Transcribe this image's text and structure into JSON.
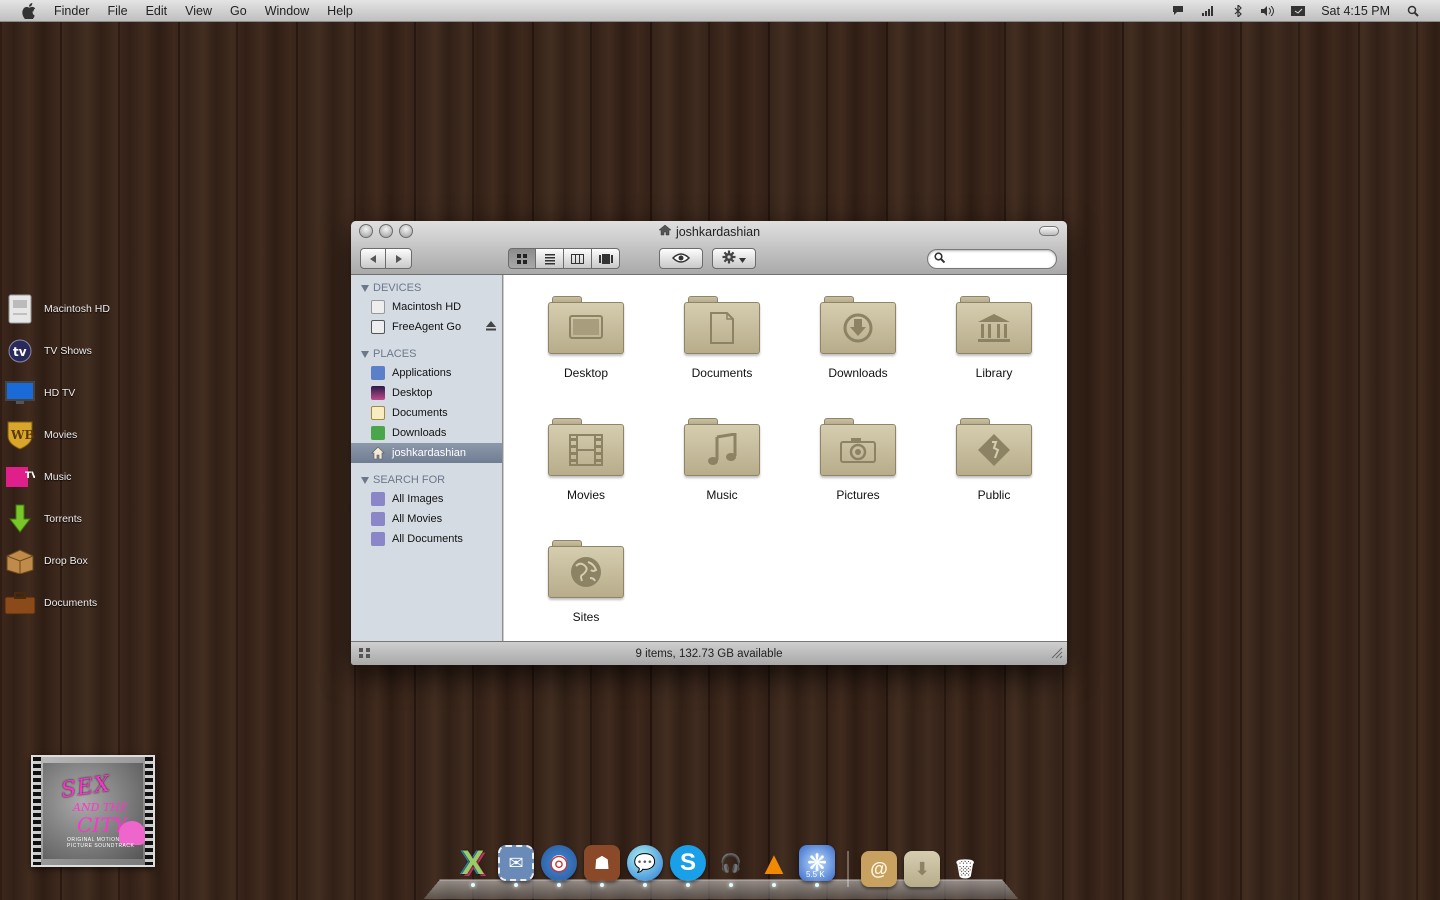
{
  "menubar": {
    "app_name": "Finder",
    "menus": [
      "File",
      "Edit",
      "View",
      "Go",
      "Window",
      "Help"
    ],
    "clock": "Sat 4:15 PM",
    "status_icons": [
      "chat-icon",
      "signal-bars-icon",
      "bluetooth-icon",
      "volume-icon",
      "battery-icon",
      "spotlight-icon"
    ]
  },
  "desktop": {
    "items": [
      {
        "label": "Macintosh HD",
        "icon": "hard-drive-icon"
      },
      {
        "label": "TV Shows",
        "icon": "tv-icon"
      },
      {
        "label": "HD TV",
        "icon": "monitor-icon"
      },
      {
        "label": "Movies",
        "icon": "wb-shield-icon"
      },
      {
        "label": "Music",
        "icon": "mtv-icon"
      },
      {
        "label": "Torrents",
        "icon": "download-arrow-icon"
      },
      {
        "label": "Drop Box",
        "icon": "box-icon"
      },
      {
        "label": "Documents",
        "icon": "briefcase-icon"
      }
    ]
  },
  "album": {
    "line1": "SEX",
    "line2": "AND THE",
    "line3": "CITY",
    "subtitle": "ORIGINAL MOTION PICTURE SOUNDTRACK"
  },
  "finder": {
    "title": "joshkardashian",
    "search_placeholder": "",
    "sidebar": {
      "sections": [
        {
          "title": "DEVICES",
          "items": [
            {
              "label": "Macintosh HD",
              "icon": "hard-drive-icon",
              "color": "#e8e8e8"
            },
            {
              "label": "FreeAgent Go",
              "icon": "external-drive-icon",
              "color": "#e8e8e8",
              "eject": true
            }
          ]
        },
        {
          "title": "PLACES",
          "items": [
            {
              "label": "Applications",
              "icon": "applications-icon",
              "color": "#5b7fc9"
            },
            {
              "label": "Desktop",
              "icon": "desktop-icon",
              "color": "#5a3a7a"
            },
            {
              "label": "Documents",
              "icon": "documents-icon",
              "color": "#f5e9b8"
            },
            {
              "label": "Downloads",
              "icon": "downloads-icon",
              "color": "#4aa64a"
            },
            {
              "label": "joshkardashian",
              "icon": "home-icon",
              "color": "#f0e6d0",
              "selected": true
            }
          ]
        },
        {
          "title": "SEARCH FOR",
          "items": [
            {
              "label": "All Images",
              "icon": "smart-folder-icon",
              "color": "#8a86c8"
            },
            {
              "label": "All Movies",
              "icon": "smart-folder-icon",
              "color": "#8a86c8"
            },
            {
              "label": "All Documents",
              "icon": "smart-folder-icon",
              "color": "#8a86c8"
            }
          ]
        }
      ]
    },
    "folders": [
      {
        "name": "Desktop",
        "icon": "desktop-folder-icon",
        "glyph": "▭"
      },
      {
        "name": "Documents",
        "icon": "documents-folder-icon",
        "glyph": "▯"
      },
      {
        "name": "Downloads",
        "icon": "downloads-folder-icon",
        "glyph": "⬇"
      },
      {
        "name": "Library",
        "icon": "library-folder-icon",
        "glyph": "🏛"
      },
      {
        "name": "Movies",
        "icon": "movies-folder-icon",
        "glyph": "🎞"
      },
      {
        "name": "Music",
        "icon": "music-folder-icon",
        "glyph": "♫"
      },
      {
        "name": "Pictures",
        "icon": "pictures-folder-icon",
        "glyph": "📷"
      },
      {
        "name": "Public",
        "icon": "public-folder-icon",
        "glyph": "◆"
      },
      {
        "name": "Sites",
        "icon": "sites-folder-icon",
        "glyph": "🌐"
      }
    ],
    "status": "9 items, 132.73 GB available"
  },
  "dock": {
    "apps": [
      {
        "name": "x-app-icon",
        "color": "#222",
        "glyph": "X"
      },
      {
        "name": "mail-stamp-icon",
        "color": "#4a6a9a",
        "glyph": "✉"
      },
      {
        "name": "safari-icon",
        "color": "#3a78c2",
        "glyph": "◎"
      },
      {
        "name": "adium-icon",
        "color": "#8a4a2a",
        "glyph": "☗"
      },
      {
        "name": "ichat-icon",
        "color": "#3a8ad8",
        "glyph": "💬"
      },
      {
        "name": "skype-icon",
        "color": "#1aa0e8",
        "glyph": "S"
      },
      {
        "name": "headphones-icon",
        "color": "#ddd",
        "glyph": "🎧"
      },
      {
        "name": "vlc-icon",
        "color": "#f08a00",
        "glyph": "▲"
      },
      {
        "name": "popcorn-icon",
        "color": "#3a6ac8",
        "glyph": "❋",
        "badge": "5.5 K"
      }
    ],
    "right": [
      {
        "name": "address-book-icon",
        "color": "#c8a060",
        "glyph": "@"
      },
      {
        "name": "downloads-stack-icon",
        "color": "#c8c0a0",
        "glyph": "⬇"
      },
      {
        "name": "trash-icon",
        "color": "#9a9a9a",
        "glyph": "🗑"
      }
    ]
  }
}
